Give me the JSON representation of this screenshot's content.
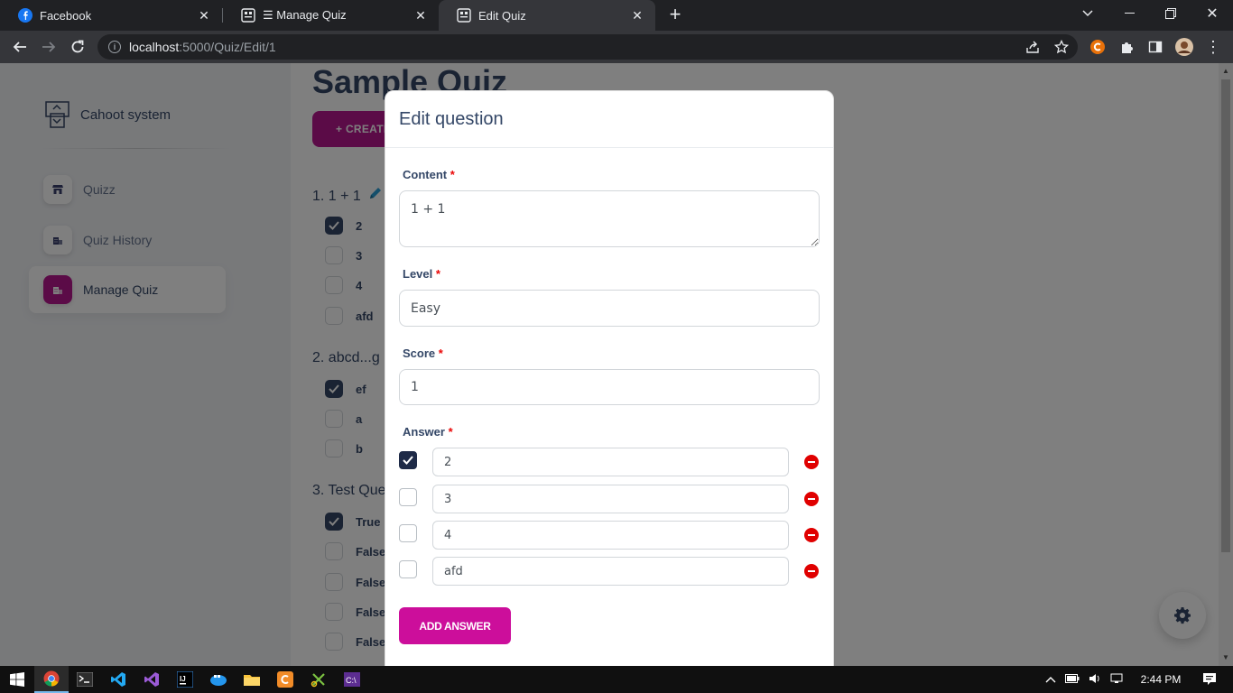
{
  "browser": {
    "tabs": [
      {
        "title": "Facebook"
      },
      {
        "title": "☰ Manage Quiz"
      },
      {
        "title": "Edit Quiz"
      }
    ],
    "url_host": "localhost",
    "url_rest": ":5000/Quiz/Edit/1"
  },
  "sidebar": {
    "brand": "Cahoot system",
    "items": [
      {
        "label": "Quizz"
      },
      {
        "label": "Quiz History"
      },
      {
        "label": "Manage Quiz"
      }
    ]
  },
  "main": {
    "title": "Sample Quiz",
    "create_label": "+ CREATE",
    "questions": [
      {
        "title": "1. 1 + 1",
        "options": [
          {
            "label": "2",
            "checked": true
          },
          {
            "label": "3",
            "checked": false
          },
          {
            "label": "4",
            "checked": false
          },
          {
            "label": "afd",
            "checked": false
          }
        ]
      },
      {
        "title": "2. abcd...g",
        "options": [
          {
            "label": "ef",
            "checked": true
          },
          {
            "label": "a",
            "checked": false
          },
          {
            "label": "b",
            "checked": false
          }
        ]
      },
      {
        "title": "3. Test Que",
        "options": [
          {
            "label": "True",
            "checked": true
          },
          {
            "label": "False",
            "checked": false
          },
          {
            "label": "False",
            "checked": false
          },
          {
            "label": "False",
            "checked": false
          },
          {
            "label": "False",
            "checked": false
          }
        ]
      }
    ]
  },
  "modal": {
    "title": "Edit question",
    "content_label": "Content",
    "content_value": "1 + 1",
    "level_label": "Level",
    "level_value": "Easy",
    "score_label": "Score",
    "score_value": "1",
    "answer_label": "Answer",
    "required_mark": "*",
    "answers": [
      {
        "value": "2",
        "correct": true
      },
      {
        "value": "3",
        "correct": false
      },
      {
        "value": "4",
        "correct": false
      },
      {
        "value": "afd",
        "correct": false
      }
    ],
    "add_answer_label": "ADD ANSWER"
  },
  "taskbar": {
    "time": "2:44 PM"
  },
  "colors": {
    "accent": "#cc0e9b",
    "remove": "#e00000"
  }
}
